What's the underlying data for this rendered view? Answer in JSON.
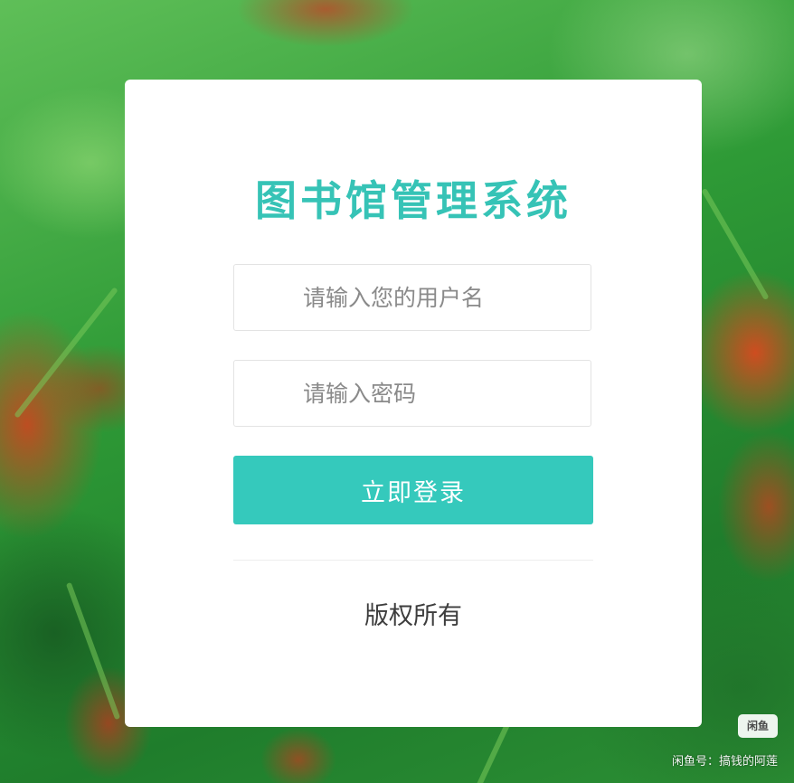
{
  "login": {
    "title": "图书馆管理系统",
    "username_placeholder": "请输入您的用户名",
    "password_placeholder": "请输入密码",
    "submit_label": "立即登录",
    "copyright": "版权所有"
  },
  "watermark": {
    "logo_text": "闲鱼",
    "text": "闲鱼号：搞钱的阿莲"
  },
  "colors": {
    "accent": "#35c9bc",
    "title": "#36c3b6",
    "card_bg": "#ffffff"
  }
}
